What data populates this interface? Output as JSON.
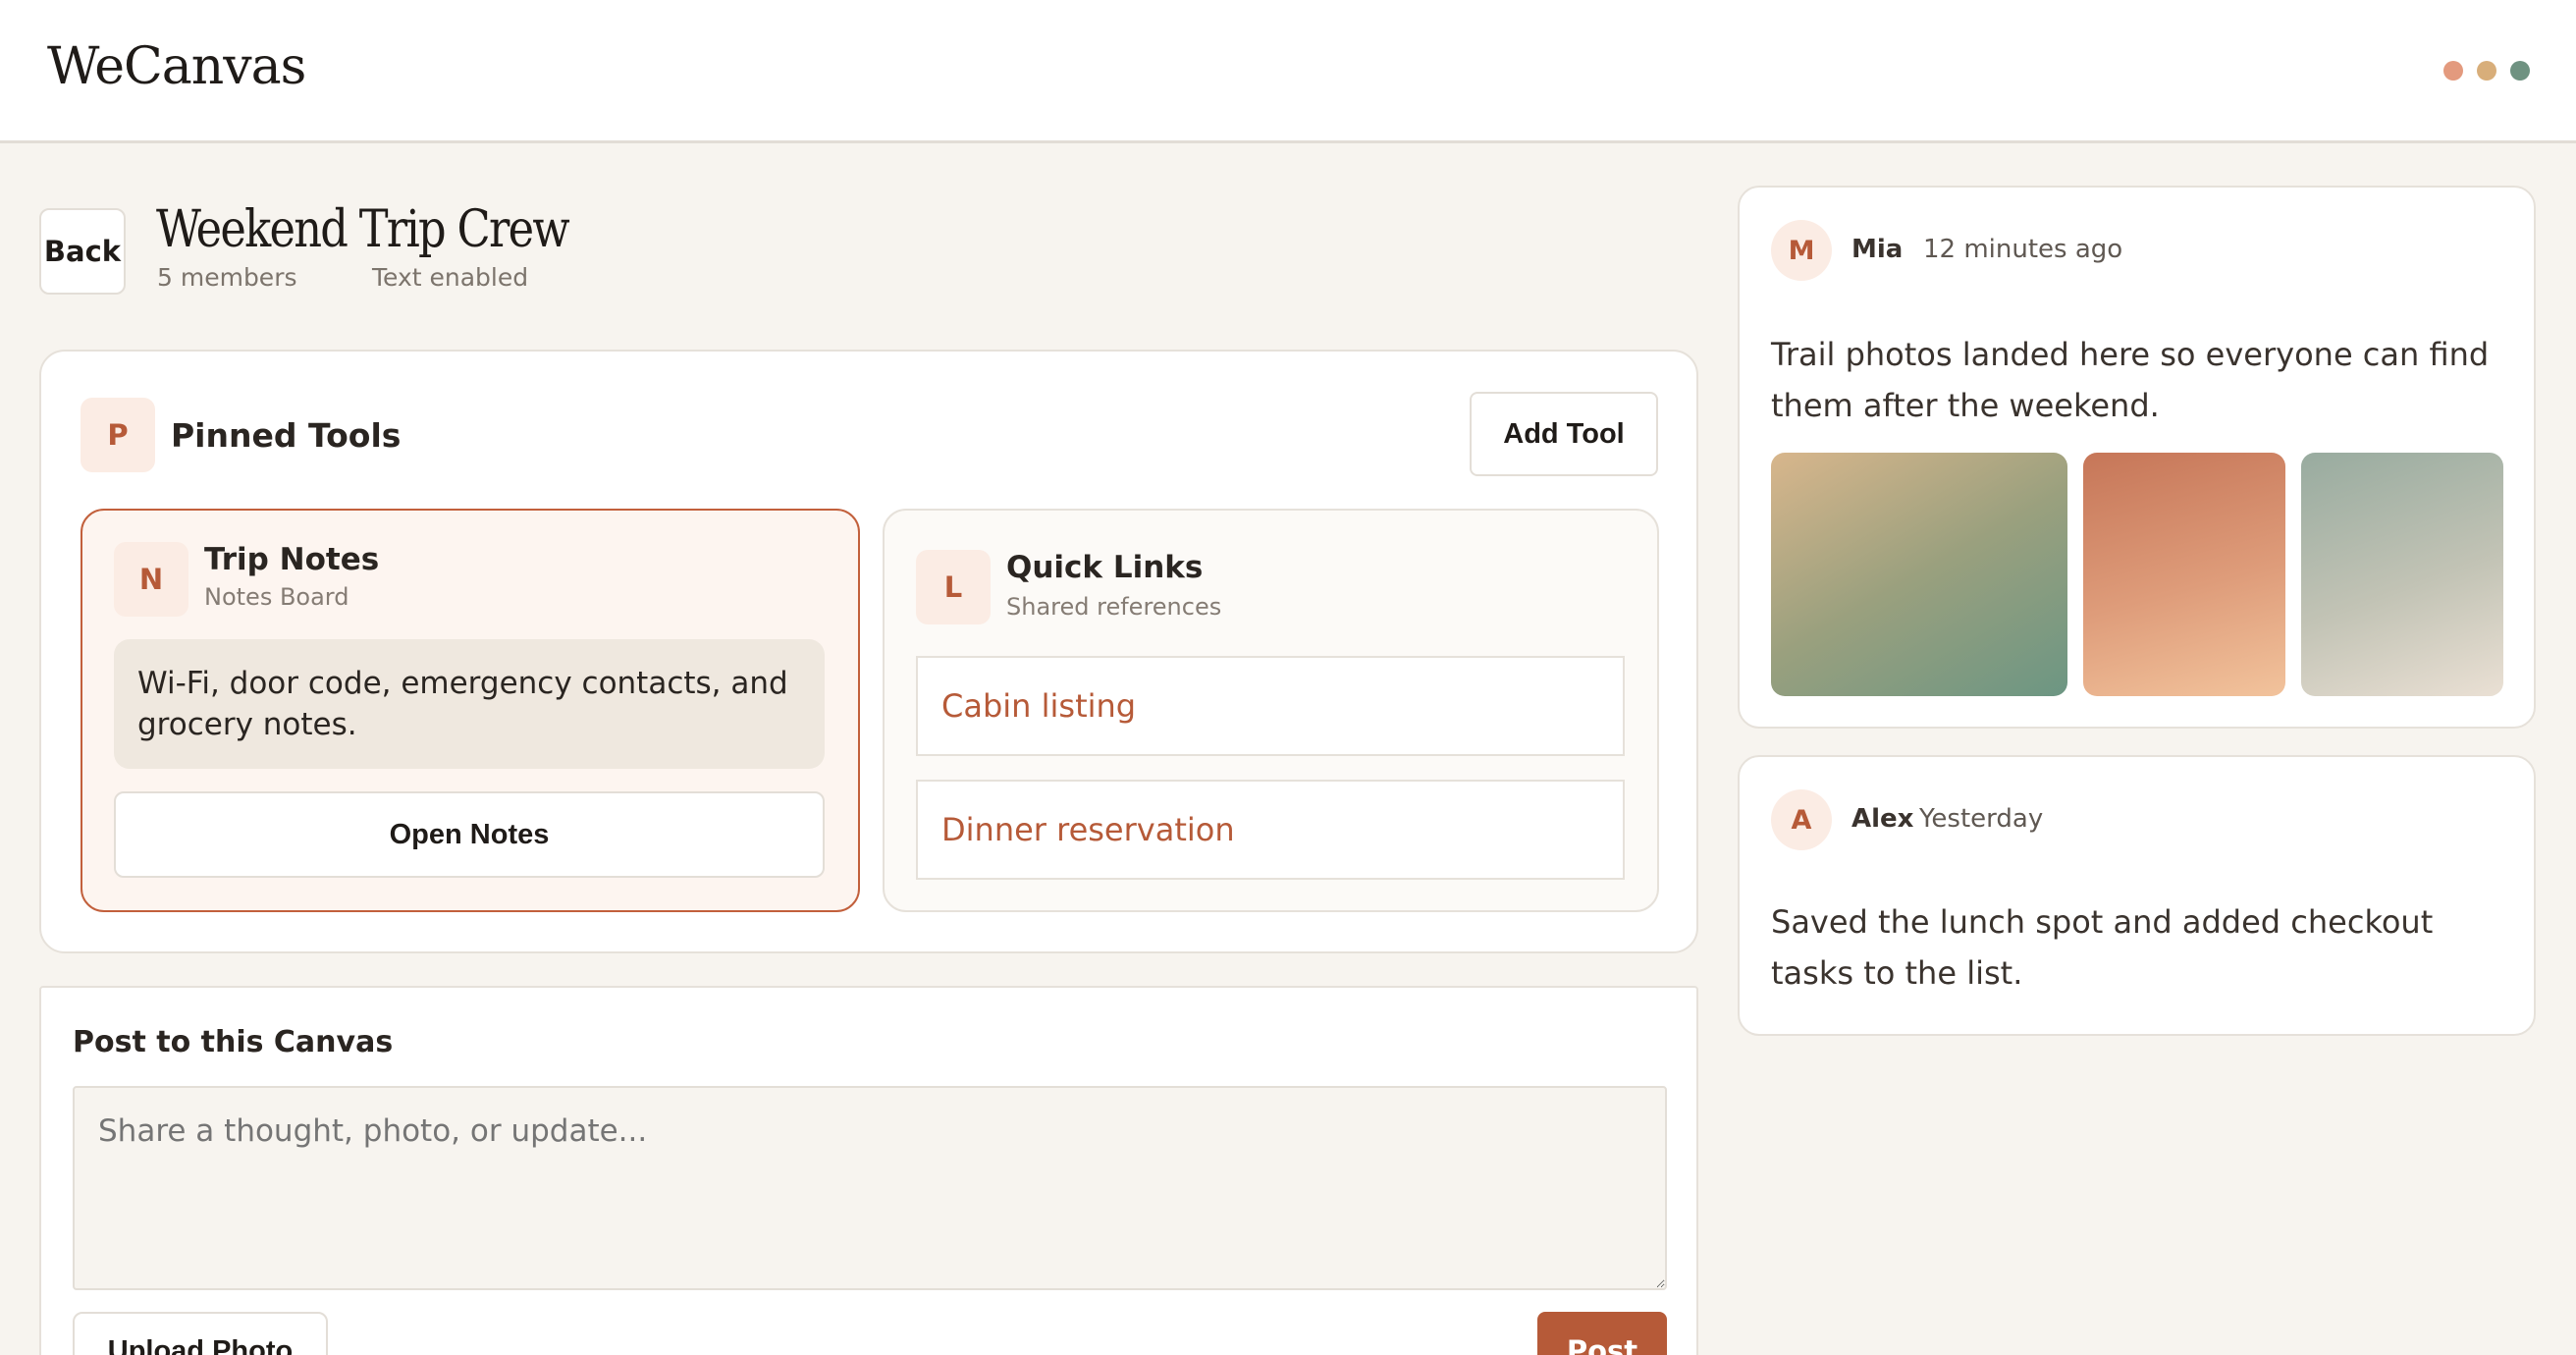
{
  "app": {
    "name": "WeCanvas"
  },
  "window_dots": [
    {
      "name": "red-dot",
      "color": "#e39a7e"
    },
    {
      "name": "yellow-dot",
      "color": "#d8ae7a"
    },
    {
      "name": "green-dot",
      "color": "#6f9281"
    }
  ],
  "canvas": {
    "back_label": "Back",
    "title": "Weekend Trip Crew",
    "members": "5 members",
    "text_status": "Text enabled"
  },
  "pinned": {
    "badge": "P",
    "title": "Pinned Tools",
    "add_label": "Add Tool",
    "notes_tool": {
      "badge": "N",
      "name": "Trip Notes",
      "subtitle": "Notes Board",
      "preview": "Wi-Fi, door code, emergency contacts, and grocery notes.",
      "open_label": "Open Notes"
    },
    "links_tool": {
      "badge": "L",
      "name": "Quick Links",
      "subtitle": "Shared references",
      "links": [
        "Cabin listing",
        "Dinner reservation"
      ]
    }
  },
  "composer": {
    "title": "Post to this Canvas",
    "placeholder": "Share a thought, photo, or update...",
    "upload_label": "Upload Photo",
    "post_label": "Post"
  },
  "feed": [
    {
      "avatar": "M",
      "author": "Mia",
      "time": "12 minutes ago",
      "text": "Trail photos landed here so everyone can find them after the weekend."
    },
    {
      "avatar": "A",
      "author": "Alex",
      "time": "Yesterday",
      "text": "Saved the lunch spot and added checkout tasks to the list."
    }
  ],
  "colors": {
    "accent": "#b65a38",
    "accent_soft": "#fbece4",
    "background": "#f7f4ef",
    "border": "#e6e1da"
  }
}
